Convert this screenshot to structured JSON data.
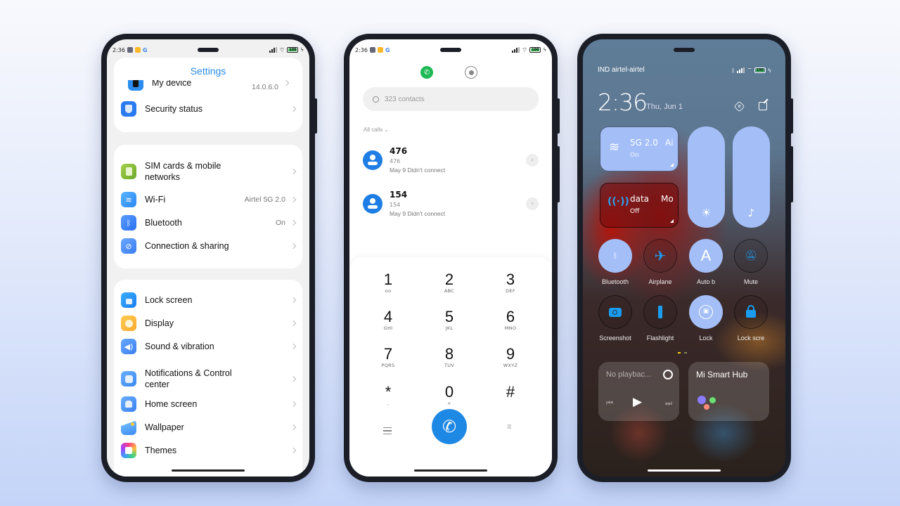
{
  "status_bar": {
    "time": "2:36",
    "battery": "100"
  },
  "settings": {
    "title": "Settings",
    "groups": [
      {
        "items": [
          {
            "label": "My device",
            "value": "14.0.6.0",
            "icon": "phone-icon",
            "color": "#2a8cf0"
          },
          {
            "label": "Security status",
            "value": "",
            "icon": "shield-icon",
            "color": "#2a7af0"
          }
        ]
      },
      {
        "items": [
          {
            "label": "SIM cards & mobile networks",
            "value": "",
            "icon": "sim-icon",
            "color": "#8cc43c"
          },
          {
            "label": "Wi-Fi",
            "value": "Airtel 5G 2.0",
            "icon": "wifi-icon",
            "color": "#3ea0f8"
          },
          {
            "label": "Bluetooth",
            "value": "On",
            "icon": "bluetooth-icon",
            "color": "#3e86f8"
          },
          {
            "label": "Connection & sharing",
            "value": "",
            "icon": "link-icon",
            "color": "#4a8cf6"
          }
        ]
      },
      {
        "items": [
          {
            "label": "Lock screen",
            "value": "",
            "icon": "lock-icon",
            "color": "#2a90f2"
          },
          {
            "label": "Display",
            "value": "",
            "icon": "sun-icon",
            "color": "#fbb540"
          },
          {
            "label": "Sound & vibration",
            "value": "",
            "icon": "speaker-icon",
            "color": "#4a90f6"
          },
          {
            "label": "Notifications & Control center",
            "value": "",
            "icon": "notification-icon",
            "color": "#4a9af4"
          },
          {
            "label": "Home screen",
            "value": "",
            "icon": "home-icon",
            "color": "#4a8cf6"
          },
          {
            "label": "Wallpaper",
            "value": "",
            "icon": "wallpaper-icon",
            "color": "#3a9af6"
          },
          {
            "label": "Themes",
            "value": "",
            "icon": "themes-icon",
            "color": "#e040a0"
          }
        ]
      }
    ]
  },
  "dialer": {
    "search_placeholder": "323 contacts",
    "filter_label": "All calls",
    "calls": [
      {
        "name": "476",
        "number": "476",
        "detail": "May 9 Didn't connect"
      },
      {
        "name": "154",
        "number": "154",
        "detail": "May 9 Didn't connect"
      }
    ],
    "keys": [
      {
        "digit": "1",
        "letters": "ᴑᴑ"
      },
      {
        "digit": "2",
        "letters": "ABC"
      },
      {
        "digit": "3",
        "letters": "DEF"
      },
      {
        "digit": "4",
        "letters": "GHI"
      },
      {
        "digit": "5",
        "letters": "JKL"
      },
      {
        "digit": "6",
        "letters": "MNO"
      },
      {
        "digit": "7",
        "letters": "PQRS"
      },
      {
        "digit": "8",
        "letters": "TUV"
      },
      {
        "digit": "9",
        "letters": "WXYZ"
      },
      {
        "digit": "*",
        "letters": ","
      },
      {
        "digit": "0",
        "letters": "+"
      },
      {
        "digit": "#",
        "letters": ""
      }
    ],
    "accent": "#1e88e5",
    "call_green": "#1db954"
  },
  "control_center": {
    "carrier": "IND airtel-airtel",
    "time": "2:36",
    "date": "Thu, Jun 1",
    "wifi_tile": {
      "title": "5G 2.0",
      "trail": "Ai",
      "status": "On"
    },
    "data_tile": {
      "title": "data",
      "trail": "Mo",
      "status": "Off"
    },
    "brightness_level": 1.0,
    "volume_level": 1.0,
    "toggles": [
      {
        "label": "Bluetooth",
        "icon": "bluetooth-icon",
        "on": true
      },
      {
        "label": "Airplane",
        "icon": "airplane-icon",
        "on": false
      },
      {
        "label": "Auto b",
        "icon": "auto-brightness-icon",
        "on": true
      },
      {
        "label": "Mute",
        "icon": "mute-icon",
        "on": false
      },
      {
        "label": "Screenshot",
        "icon": "camera-icon",
        "on": false
      },
      {
        "label": "Flashlight",
        "icon": "flashlight-icon",
        "on": false
      },
      {
        "label": "Lock",
        "icon": "rotation-lock-icon",
        "on": true
      },
      {
        "label": "Lock scre",
        "icon": "padlock-icon",
        "on": false
      }
    ],
    "media": {
      "text": "No playbac..."
    },
    "smart_hub": {
      "title": "Mi Smart Hub"
    },
    "tile_color": "#a4bff8",
    "icon_blue": "#1a9cf0"
  }
}
